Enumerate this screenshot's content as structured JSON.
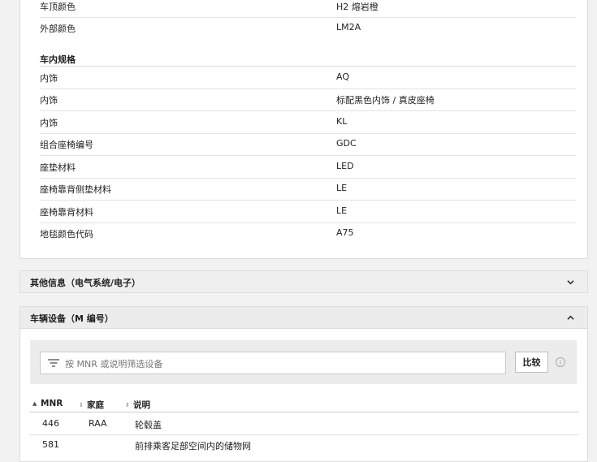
{
  "exterior": {
    "rows": [
      {
        "label": "车顶颜色",
        "value": "H2 熔岩橙"
      },
      {
        "label": "外部颜色",
        "value": "LM2A"
      }
    ]
  },
  "interior": {
    "title": "车内规格",
    "rows": [
      {
        "label": "内饰",
        "value": "AQ"
      },
      {
        "label": "内饰",
        "value": "标配黑色内饰 / 真皮座椅"
      },
      {
        "label": "内饰",
        "value": "KL"
      },
      {
        "label": "组合座椅编号",
        "value": "GDC"
      },
      {
        "label": "座垫材料",
        "value": "LED"
      },
      {
        "label": "座椅靠背侧垫材料",
        "value": "LE"
      },
      {
        "label": "座椅靠背材料",
        "value": "LE"
      },
      {
        "label": "地毯颜色代码",
        "value": "A75"
      }
    ]
  },
  "other_info": {
    "title": "其他信息（电气系统/电子）",
    "icon": "chevron-down-icon"
  },
  "equipment": {
    "title": "车辆设备（M 编号）",
    "icon": "chevron-up-icon",
    "search_placeholder": "按 MNR 或说明筛选设备",
    "compare_label": "比较",
    "info_glyph": "i",
    "columns": [
      "MNR",
      "家庭",
      "说明"
    ],
    "rows": [
      {
        "mnr": "446",
        "family": "RAA",
        "desc": "轮毂盖"
      },
      {
        "mnr": "581",
        "family": "",
        "desc": "前排乘客足部空间内的储物网"
      }
    ]
  }
}
